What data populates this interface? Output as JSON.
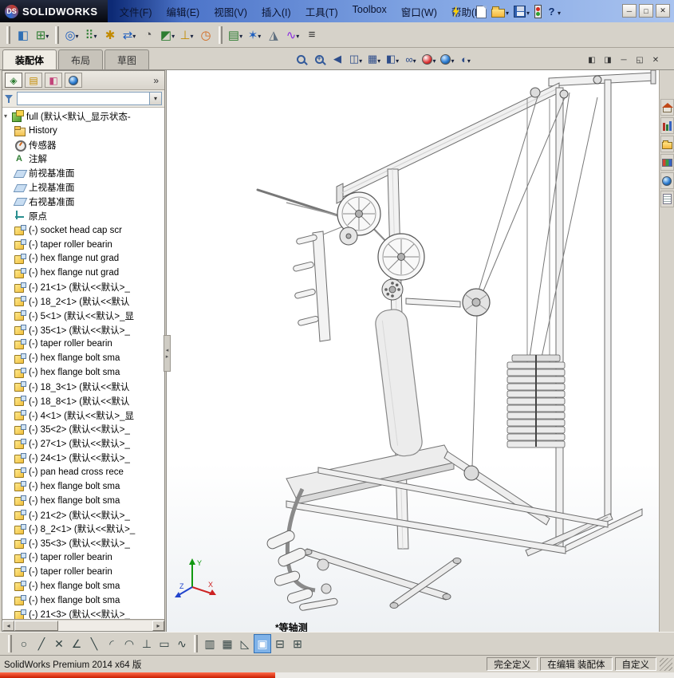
{
  "brand": {
    "badge": "DS",
    "name": "SOLIDWORKS"
  },
  "menus": [
    "文件(F)",
    "编辑(E)",
    "视图(V)",
    "插入(I)",
    "工具(T)",
    "Toolbox",
    "窗口(W)",
    "帮助(H)"
  ],
  "quick_toolbar": {
    "help_glyph": "?"
  },
  "window_controls": [
    {
      "name": "minimize",
      "glyph": "─"
    },
    {
      "name": "maximize",
      "glyph": "□"
    },
    {
      "name": "close",
      "glyph": "✕"
    }
  ],
  "assembly_toolbar": [
    {
      "name": "edit-component",
      "glyph": "◧"
    },
    {
      "name": "insert-components",
      "glyph": "⊞",
      "dropdown": true
    },
    {
      "name": "mate",
      "glyph": "◎",
      "dropdown": true
    },
    {
      "name": "linear-component-pattern",
      "glyph": "⠿",
      "dropdown": true
    },
    {
      "name": "smart-fasteners",
      "glyph": "✱"
    },
    {
      "name": "move-component",
      "glyph": "⇄",
      "dropdown": true
    },
    {
      "name": "show-hidden-components",
      "glyph": "◔"
    },
    {
      "name": "assembly-features",
      "glyph": "◩",
      "dropdown": true
    },
    {
      "name": "reference-geometry",
      "glyph": "⊥",
      "dropdown": true
    },
    {
      "name": "new-motion-study",
      "glyph": "◷"
    },
    {
      "name": "bill-of-materials",
      "glyph": "▤",
      "dropdown": true
    },
    {
      "name": "exploded-view",
      "glyph": "✶",
      "dropdown": true
    },
    {
      "name": "instant3d",
      "glyph": "◮"
    },
    {
      "name": "curves",
      "glyph": "∿",
      "dropdown": true
    },
    {
      "name": "update-holders",
      "glyph": "≡"
    }
  ],
  "command_tabs": {
    "items": [
      "装配体",
      "布局",
      "草图"
    ],
    "active": "装配体"
  },
  "hud_toolbar": [
    {
      "name": "zoom-to-fit",
      "shape": "magnifier"
    },
    {
      "name": "zoom-to-area",
      "shape": "magnifier-plus"
    },
    {
      "name": "previous-view",
      "glyph": "◀"
    },
    {
      "name": "section-view",
      "glyph": "◫",
      "dropdown": true
    },
    {
      "name": "view-orientation",
      "glyph": "▦",
      "dropdown": true
    },
    {
      "name": "display-style",
      "glyph": "◧",
      "dropdown": true
    },
    {
      "name": "hide-show-items",
      "glyph": "∞",
      "dropdown": true
    },
    {
      "name": "edit-appearance",
      "shape": "sphere-red",
      "dropdown": true
    },
    {
      "name": "apply-scene",
      "shape": "sphere-earth",
      "dropdown": true
    },
    {
      "name": "view-settings",
      "glyph": "◐",
      "dropdown": true
    }
  ],
  "doc_controls": [
    {
      "name": "pane-left",
      "glyph": "◧"
    },
    {
      "name": "pane-right",
      "glyph": "◨"
    },
    {
      "name": "doc-minimize",
      "glyph": "─"
    },
    {
      "name": "doc-restore",
      "glyph": "◱"
    },
    {
      "name": "doc-close",
      "glyph": "✕"
    }
  ],
  "panel": {
    "tabs": [
      {
        "name": "featuremanager-tab",
        "glyph": "◈"
      },
      {
        "name": "propertymanager-tab",
        "glyph": "▤"
      },
      {
        "name": "configurationmanager-tab",
        "glyph": "◧"
      },
      {
        "name": "displaymanager-tab",
        "shape": "sphere"
      }
    ],
    "overflow_glyph": "»",
    "filter_value": "",
    "hscroll": {
      "left": "◂",
      "right": "▸"
    },
    "tree": {
      "root": "full (默认<默认_显示状态-",
      "items": [
        {
          "icon": "history",
          "label": "History"
        },
        {
          "icon": "sensors",
          "label": "传感器"
        },
        {
          "icon": "annotations",
          "label": "注解"
        },
        {
          "icon": "plane",
          "label": "前视基准面"
        },
        {
          "icon": "plane",
          "label": "上视基准面"
        },
        {
          "icon": "plane",
          "label": "右视基准面"
        },
        {
          "icon": "origin",
          "label": "原点"
        },
        {
          "icon": "component",
          "label": "(-) socket head cap scr"
        },
        {
          "icon": "component",
          "label": "(-) taper roller bearin"
        },
        {
          "icon": "component",
          "label": "(-) hex flange nut grad"
        },
        {
          "icon": "component",
          "label": "(-) hex flange nut grad"
        },
        {
          "icon": "component",
          "label": "(-) 21<1> (默认<<默认>_"
        },
        {
          "icon": "component",
          "label": "(-) 18_2<1> (默认<<默认"
        },
        {
          "icon": "component",
          "label": "(-) 5<1> (默认<<默认>_显"
        },
        {
          "icon": "component",
          "label": "(-) 35<1> (默认<<默认>_"
        },
        {
          "icon": "component",
          "label": "(-) taper roller bearin"
        },
        {
          "icon": "component",
          "label": "(-) hex flange bolt sma"
        },
        {
          "icon": "component",
          "label": "(-) hex flange bolt sma"
        },
        {
          "icon": "component",
          "label": "(-) 18_3<1> (默认<<默认"
        },
        {
          "icon": "component",
          "label": "(-) 18_8<1> (默认<<默认"
        },
        {
          "icon": "component",
          "label": "(-) 4<1> (默认<<默认>_显"
        },
        {
          "icon": "component",
          "label": "(-) 35<2> (默认<<默认>_"
        },
        {
          "icon": "component",
          "label": "(-) 27<1> (默认<<默认>_"
        },
        {
          "icon": "component",
          "label": "(-) 24<1> (默认<<默认>_"
        },
        {
          "icon": "component",
          "label": "(-) pan head cross rece"
        },
        {
          "icon": "component",
          "label": "(-) hex flange bolt sma"
        },
        {
          "icon": "component",
          "label": "(-) hex flange bolt sma"
        },
        {
          "icon": "component",
          "label": "(-) 21<2> (默认<<默认>_"
        },
        {
          "icon": "component",
          "label": "(-) 8_2<1> (默认<<默认>_"
        },
        {
          "icon": "component",
          "label": "(-) 35<3> (默认<<默认>_"
        },
        {
          "icon": "component",
          "label": "(-) taper roller bearin"
        },
        {
          "icon": "component",
          "label": "(-) taper roller bearin"
        },
        {
          "icon": "component",
          "label": "(-) hex flange bolt sma"
        },
        {
          "icon": "component",
          "label": "(-) hex flange bolt sma"
        },
        {
          "icon": "component",
          "label": "(-) 21<3> (默认<<默认>_"
        }
      ]
    }
  },
  "taskpane_icons": [
    "solidworks-resources",
    "design-library",
    "file-explorer",
    "view-palette",
    "appearances-scenes",
    "custom-properties"
  ],
  "sketch_toolbar": {
    "left": [
      {
        "name": "sketch-circle",
        "glyph": "○"
      },
      {
        "name": "sketch-line",
        "glyph": "╱"
      },
      {
        "name": "trim-entities",
        "glyph": "✕"
      },
      {
        "name": "sketch-fillet",
        "glyph": "∠"
      },
      {
        "name": "centerline",
        "glyph": "╲"
      },
      {
        "name": "centerpoint-arc",
        "glyph": "◜"
      },
      {
        "name": "tangent-arc",
        "glyph": "◠"
      },
      {
        "name": "add-relation",
        "glyph": "⊥"
      },
      {
        "name": "corner-rectangle",
        "glyph": "▭"
      },
      {
        "name": "spline",
        "glyph": "∿"
      }
    ],
    "right": [
      {
        "name": "grid-settings",
        "glyph": "▥"
      },
      {
        "name": "snap-options",
        "glyph": "▦"
      },
      {
        "name": "draft-quality",
        "glyph": "◺"
      },
      {
        "name": "viewport-single",
        "glyph": "▣",
        "active": true
      },
      {
        "name": "viewport-two",
        "glyph": "⊟"
      },
      {
        "name": "viewport-four",
        "glyph": "⊞"
      }
    ]
  },
  "viewport": {
    "view_label": "*等轴测",
    "triad": {
      "x": "X",
      "y": "Y",
      "z": "Z"
    }
  },
  "statusbar": {
    "product": "SolidWorks Premium 2014 x64 版",
    "fields": [
      "完全定义",
      "在编辑 装配体",
      "自定义"
    ]
  },
  "colors": {
    "titlebar_start": "#0d2a75",
    "titlebar_end": "#a9c3ef",
    "toolbar_bg": "#d6d2c9",
    "viewport_bg": "#ffffff",
    "active_button": "#7fb2e8",
    "status_strip_red": "#c81e00",
    "triad_x": "#cc2222",
    "triad_y": "#119911",
    "triad_z": "#2244cc"
  }
}
